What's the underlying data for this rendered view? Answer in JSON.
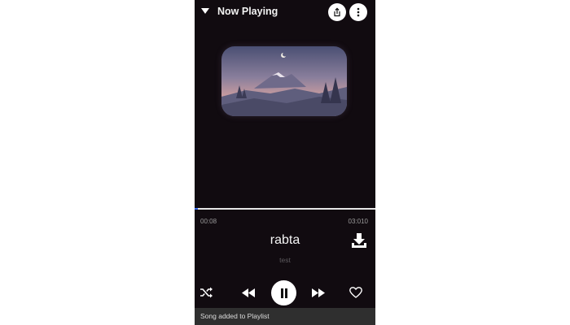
{
  "header": {
    "title": "Now Playing",
    "back_icon": "caret-down-icon",
    "share_icon": "share-icon",
    "more_icon": "more-vertical-icon"
  },
  "artwork": {
    "description_icon": "album-art-image"
  },
  "player": {
    "elapsed": "00:08",
    "total": "03:010",
    "progress_fraction": 0.02,
    "song_title": "rabta",
    "artist": "test"
  },
  "controls": {
    "shuffle_icon": "shuffle-icon",
    "previous_icon": "rewind-icon",
    "play_pause_icon": "pause-icon",
    "next_icon": "fast-forward-icon",
    "favorite_icon": "heart-outline-icon",
    "download_icon": "download-icon"
  },
  "snackbar": {
    "message": "Song added to Playlist"
  },
  "colors": {
    "background": "#110b10",
    "accent": "#3a6df0",
    "text_primary": "#f5f5f5",
    "text_secondary": "#5d5a5e",
    "snackbar": "#2f2f2f"
  }
}
